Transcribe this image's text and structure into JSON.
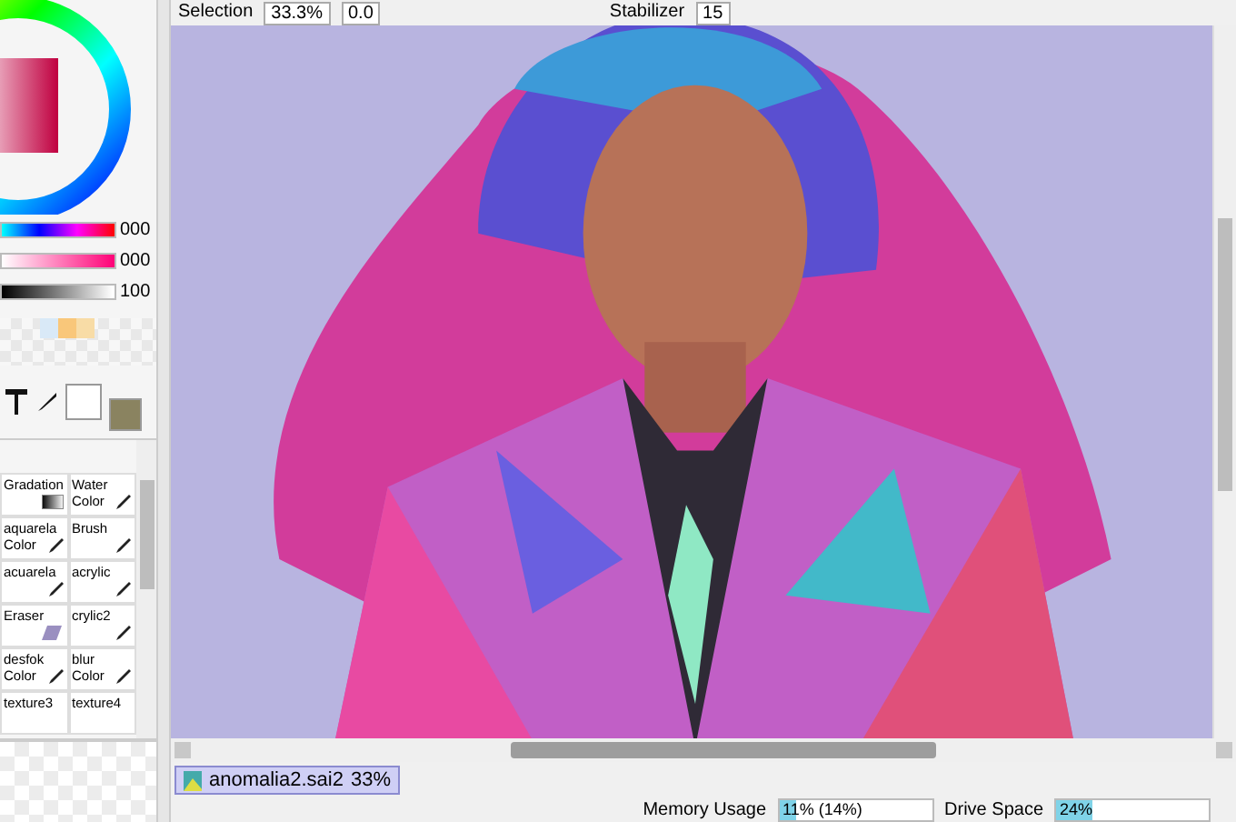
{
  "toolbar": {
    "selection_label": "Selection",
    "zoom": "33.3%",
    "rotation": "0.0",
    "stabilizer_label": "Stabilizer",
    "stabilizer": "15"
  },
  "color_panel": {
    "sliders": [
      {
        "kind": "hue",
        "value": "000",
        "level": 1
      },
      {
        "kind": "saturation",
        "value": "000",
        "level": 1
      },
      {
        "kind": "value",
        "value": "100",
        "level": 0.98
      }
    ],
    "swatches": [
      {
        "color": "#d9e9f7"
      },
      {
        "color": "#f9c77a"
      },
      {
        "color": "#f8dca6"
      }
    ],
    "color_boxes": [
      {
        "kind": "primary",
        "color": "#ffffff"
      },
      {
        "kind": "secondary",
        "color": "#8a8360"
      }
    ]
  },
  "tools": [
    {
      "label": "Gradation",
      "kind": "gradient",
      "selected": false
    },
    {
      "label": "Water Color",
      "kind": "brush",
      "selected": false
    },
    {
      "label": "aquarela Color",
      "kind": "brush",
      "selected": false
    },
    {
      "label": "Brush",
      "kind": "brush",
      "selected": false
    },
    {
      "label": "acuarela",
      "kind": "brush",
      "selected": false
    },
    {
      "label": "acrylic",
      "kind": "brush",
      "selected": false
    },
    {
      "label": "Eraser",
      "kind": "eraser",
      "selected": false
    },
    {
      "label": "crylic2",
      "kind": "brush",
      "selected": false
    },
    {
      "label": "desfok Color",
      "kind": "brush",
      "selected": false
    },
    {
      "label": "blur Color",
      "kind": "brush",
      "selected": false
    },
    {
      "label": "texture3",
      "kind": "plain",
      "selected": false
    },
    {
      "label": "texture4",
      "kind": "plain",
      "selected": false
    }
  ],
  "documents": [
    {
      "name": "anomalia2.sai2",
      "zoom": "33%",
      "selected": true
    }
  ],
  "status_bar": {
    "meters": [
      {
        "label": "Memory Usage",
        "value": "11% (14%)",
        "level": 0.11
      },
      {
        "label": "Drive Space",
        "value": "24%",
        "level": 0.24
      }
    ]
  }
}
